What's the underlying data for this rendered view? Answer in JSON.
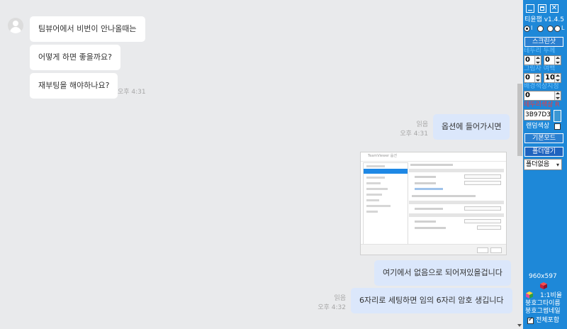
{
  "chat": {
    "messages_in": [
      "팀뷰어에서 비번이 안나올때는",
      "어떻게 하면 좋을까요?",
      "재부팅을 해야하나요?"
    ],
    "in_time": "오후 4:31",
    "out_1": {
      "text": "옵션에 들어가시면",
      "read": "읽음",
      "time": "오후 4:31"
    },
    "out_2": {
      "text": "여기에서 없음으로 되어져있을겁니다"
    },
    "out_3": {
      "text": "6자리로 세팅하면 임의 6자리 암호 생깁니다",
      "read": "읽음",
      "time": "오후 4:32"
    }
  },
  "panel": {
    "title": "티윤챕 v1.4.5",
    "radio_labels": [
      "I",
      "L"
    ],
    "screenshot_button": "스크린샷",
    "border_thickness_label": "테두리 두께",
    "border_values": [
      "0",
      "0"
    ],
    "shadow_label": "그림자 여백",
    "shadow_values": [
      "0",
      "10"
    ],
    "background_label": "배경색상지정",
    "background_value": "0",
    "border_color_label": "테두리색상 R",
    "border_color_value": "3B97D3",
    "border_color_hex": "#3b97d3",
    "random_color_label": "랜덤색상",
    "default_mode_button": "기본모드",
    "open_folder_button": "폴더열기",
    "folder_select": "폴더없음",
    "size_readout": "960x597",
    "ratio_label": "1:1비율",
    "type_label": "붕호그타이름",
    "thumb_label": "붕호그썸네일",
    "include_all_label": "전체포함"
  }
}
